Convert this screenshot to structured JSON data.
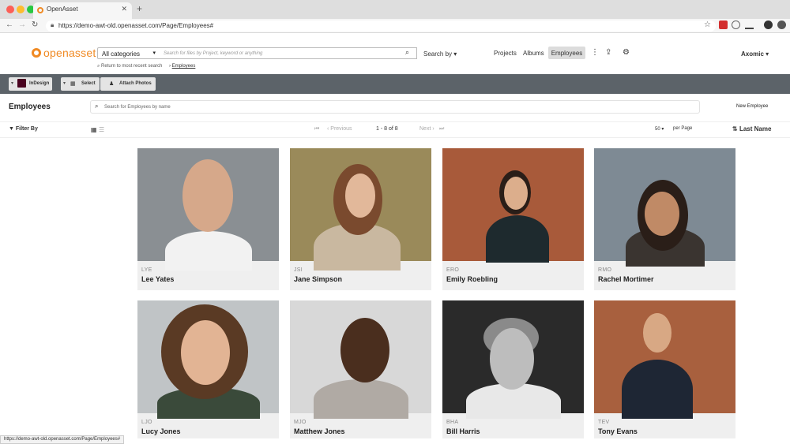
{
  "browser": {
    "tab_title": "OpenAsset",
    "url": "https://demo-awt-old.openasset.com/Page/Employees#",
    "status_url": "https://demo-awt-old.openasset.com/Page/Employees#"
  },
  "header": {
    "logo_text": "openasset",
    "category_select": "All categories",
    "search_placeholder": "Search for files by Project, keyword or anything",
    "search_by": "Search by",
    "nav": [
      "Projects",
      "Albums",
      "Employees"
    ],
    "user": "Axomic",
    "return_link": "Return to most recent search",
    "breadcrumb": "Employees"
  },
  "toolbar": {
    "indesign": "InDesign",
    "select": "Select",
    "attach": "Attach Photos"
  },
  "page": {
    "title": "Employees",
    "search_placeholder": "Search for Employees by name",
    "new_button": "New Employee",
    "filter_by": "Filter By",
    "prev": "‹ Previous",
    "range": "1 - 8 of 8",
    "next": "Next ›",
    "per_page_value": "50",
    "per_page_label": "per Page",
    "sort": "Last Name"
  },
  "employees": [
    {
      "initials": "LYE",
      "name": "Lee Yates"
    },
    {
      "initials": "JSI",
      "name": "Jane Simpson"
    },
    {
      "initials": "ERO",
      "name": "Emily Roebling"
    },
    {
      "initials": "RMO",
      "name": "Rachel Mortimer"
    },
    {
      "initials": "LJO",
      "name": "Lucy Jones"
    },
    {
      "initials": "MJO",
      "name": "Matthew Jones"
    },
    {
      "initials": "BHA",
      "name": "Bill Harris"
    },
    {
      "initials": "TEV",
      "name": "Tony Evans"
    }
  ],
  "colors": {
    "brand_orange": "#f08a24",
    "toolbar_bg": "#5c6369",
    "indesign": "#49021f"
  }
}
